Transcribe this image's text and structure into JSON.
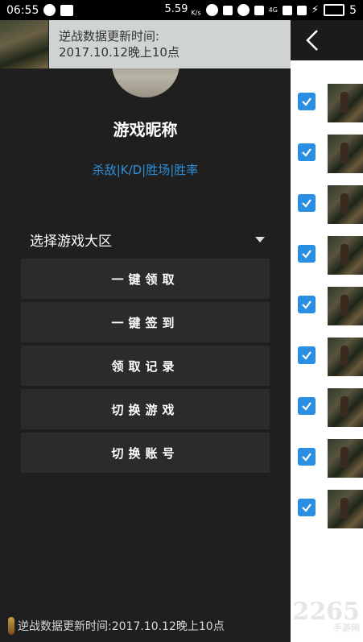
{
  "status_bar": {
    "time": "06:55",
    "speed_value": "5.59",
    "speed_unit": "K/s",
    "signal_label": "4G",
    "battery": "5"
  },
  "drawer": {
    "notice_line1": "逆战数据更新时间:",
    "notice_line2": "2017.10.12晚上10点",
    "nickname": "游戏昵称",
    "stats": "杀敌|K/D|胜场|胜率",
    "select_label": "选择游戏大区",
    "buttons": [
      {
        "label": "一键领取"
      },
      {
        "label": "一键签到"
      },
      {
        "label": "领取记录"
      },
      {
        "label": "切换游戏"
      },
      {
        "label": "切换账号"
      }
    ],
    "footer_text": "逆战数据更新时间:2017.10.12晚上10点"
  },
  "right_panel": {
    "items_checked": [
      true,
      true,
      true,
      true,
      true,
      true,
      true,
      true,
      true
    ]
  },
  "watermark": {
    "main": "2265",
    "sub": "手游网"
  },
  "colors": {
    "accent_blue": "#2a8fe3",
    "stats_blue": "#2d8fd9",
    "drawer_bg": "#1f1f1f",
    "button_bg": "#2b2b2b"
  }
}
